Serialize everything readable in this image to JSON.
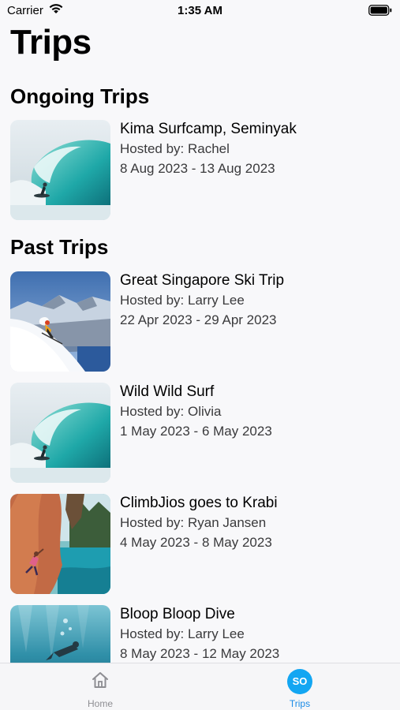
{
  "status_bar": {
    "carrier": "Carrier",
    "time": "1:35 AM"
  },
  "page": {
    "title": "Trips"
  },
  "sections": {
    "ongoing": {
      "title": "Ongoing Trips",
      "trips": [
        {
          "name": "Kima Surfcamp, Seminyak",
          "host": "Hosted by: Rachel",
          "dates": "8 Aug 2023 - 13 Aug 2023",
          "image": "surf-wave-image"
        }
      ]
    },
    "past": {
      "title": "Past Trips",
      "trips": [
        {
          "name": "Great Singapore Ski Trip",
          "host": "Hosted by: Larry Lee",
          "dates": "22 Apr 2023 - 29 Apr 2023",
          "image": "ski-image"
        },
        {
          "name": "Wild Wild Surf",
          "host": "Hosted by: Olivia",
          "dates": "1 May 2023 - 6 May 2023",
          "image": "surf-wave-image"
        },
        {
          "name": "ClimbJios goes to Krabi",
          "host": "Hosted by: Ryan Jansen",
          "dates": "4 May 2023 - 8 May 2023",
          "image": "climbing-image"
        },
        {
          "name": "Bloop Bloop Dive",
          "host": "Hosted by: Larry Lee",
          "dates": "8 May 2023 - 12 May 2023",
          "image": "dive-image"
        }
      ]
    }
  },
  "tabbar": {
    "home": {
      "label": "Home",
      "icon": "house-icon"
    },
    "trips": {
      "label": "Trips",
      "badge": "SO"
    }
  },
  "colors": {
    "accent": "#1a8be6",
    "badge": "#13a6f2",
    "inactive": "#8e8e93"
  }
}
